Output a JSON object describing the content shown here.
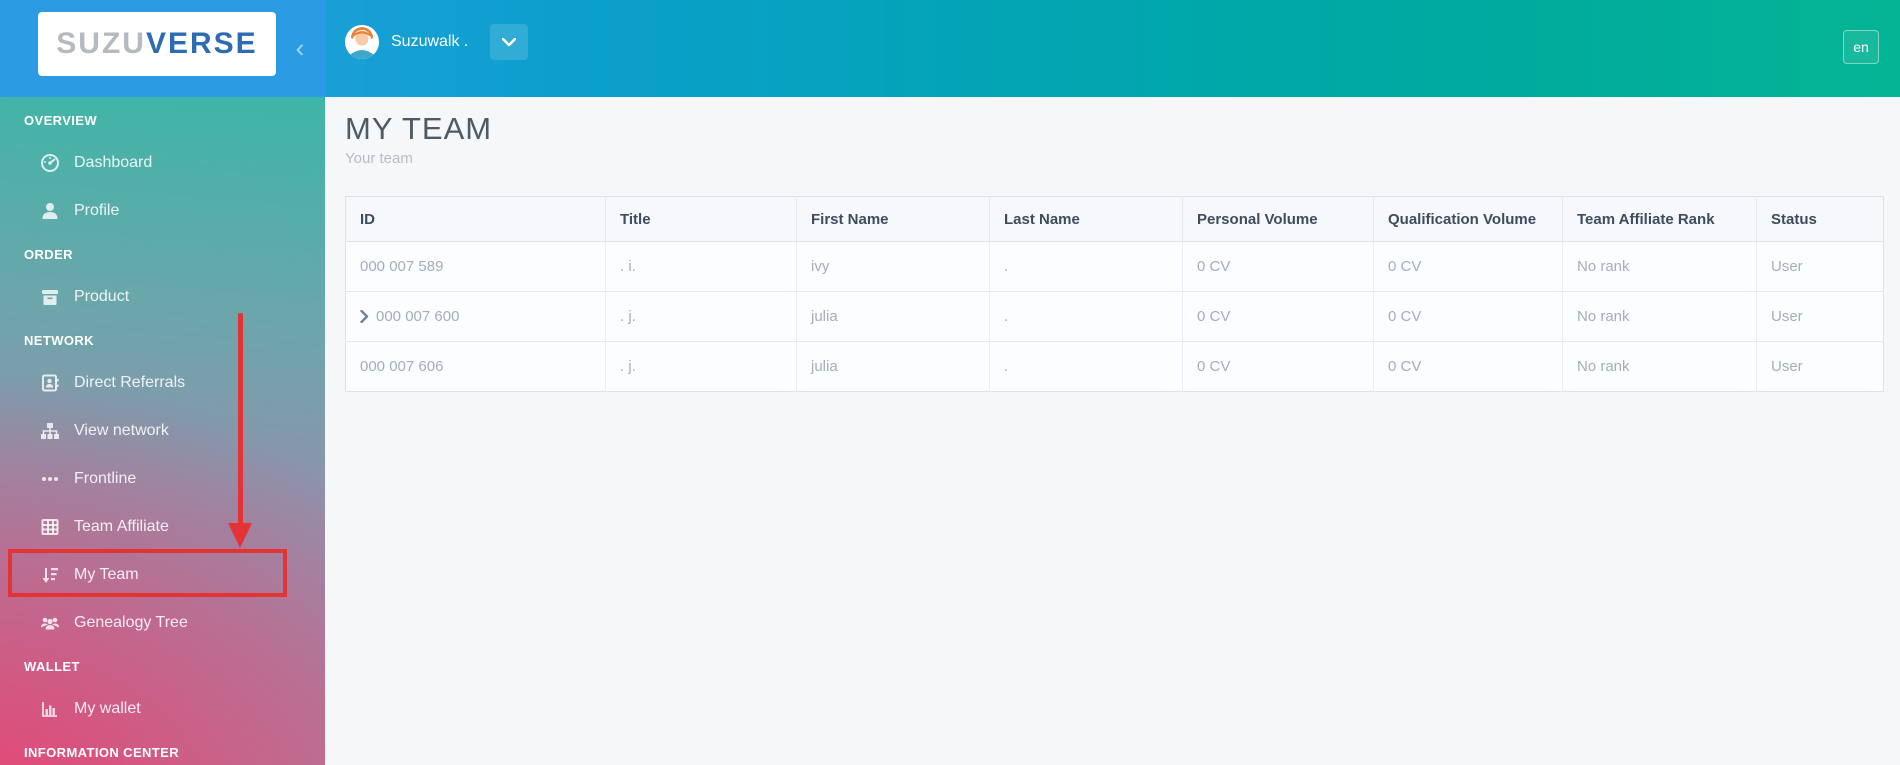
{
  "brand": {
    "logo_part1": "SUZU",
    "logo_part2": "VERSE",
    "collapse_icon": "chevron-left"
  },
  "topbar": {
    "user_name": "Suzuwalk .",
    "language": "en"
  },
  "sidebar": {
    "sections": [
      {
        "label": "OVERVIEW",
        "items": [
          {
            "label": "Dashboard",
            "icon": "dashboard-gauge-icon"
          },
          {
            "label": "Profile",
            "icon": "user-icon"
          }
        ]
      },
      {
        "label": "ORDER",
        "items": [
          {
            "label": "Product",
            "icon": "product-box-icon"
          }
        ]
      },
      {
        "label": "NETWORK",
        "items": [
          {
            "label": "Direct Referrals",
            "icon": "address-book-icon"
          },
          {
            "label": "View network",
            "icon": "sitemap-icon"
          },
          {
            "label": "Frontline",
            "icon": "ellipsis-icon"
          },
          {
            "label": "Team Affiliate",
            "icon": "table-grid-icon"
          },
          {
            "label": "My Team",
            "icon": "sort-amount-icon",
            "annotated": true
          },
          {
            "label": "Genealogy Tree",
            "icon": "users-group-icon"
          }
        ]
      },
      {
        "label": "WALLET",
        "items": [
          {
            "label": "My wallet",
            "icon": "bar-chart-icon"
          }
        ]
      },
      {
        "label": "INFORMATION CENTER",
        "items": []
      }
    ]
  },
  "page": {
    "title": "MY TEAM",
    "subtitle": "Your team"
  },
  "table": {
    "columns": [
      "ID",
      "Title",
      "First Name",
      "Last Name",
      "Personal Volume",
      "Qualification Volume",
      "Team Affiliate Rank",
      "Status"
    ],
    "rows": [
      {
        "id": "000 007 589",
        "expandable": false,
        "title": ". i.",
        "first_name": "ivy",
        "last_name": ".",
        "personal_volume": "0 CV",
        "qualification_volume": "0 CV",
        "team_affiliate_rank": "No rank",
        "status": "User"
      },
      {
        "id": "000 007 600",
        "expandable": true,
        "title": ". j.",
        "first_name": "julia",
        "last_name": ".",
        "personal_volume": "0 CV",
        "qualification_volume": "0 CV",
        "team_affiliate_rank": "No rank",
        "status": "User"
      },
      {
        "id": "000 007 606",
        "expandable": false,
        "title": ". j.",
        "first_name": "julia",
        "last_name": ".",
        "personal_volume": "0 CV",
        "qualification_volume": "0 CV",
        "team_affiliate_rank": "No rank",
        "status": "User"
      }
    ]
  },
  "colors": {
    "accent_red": "#e23434",
    "brand_blue": "#2b9ce4",
    "topbar_teal": "#00a89f",
    "logo_gray": "#b4bac0",
    "logo_blue": "#2d6cb3",
    "sidebar_top_teal": "#3cb6a7",
    "sidebar_bottom_pink": "#e85c81"
  }
}
